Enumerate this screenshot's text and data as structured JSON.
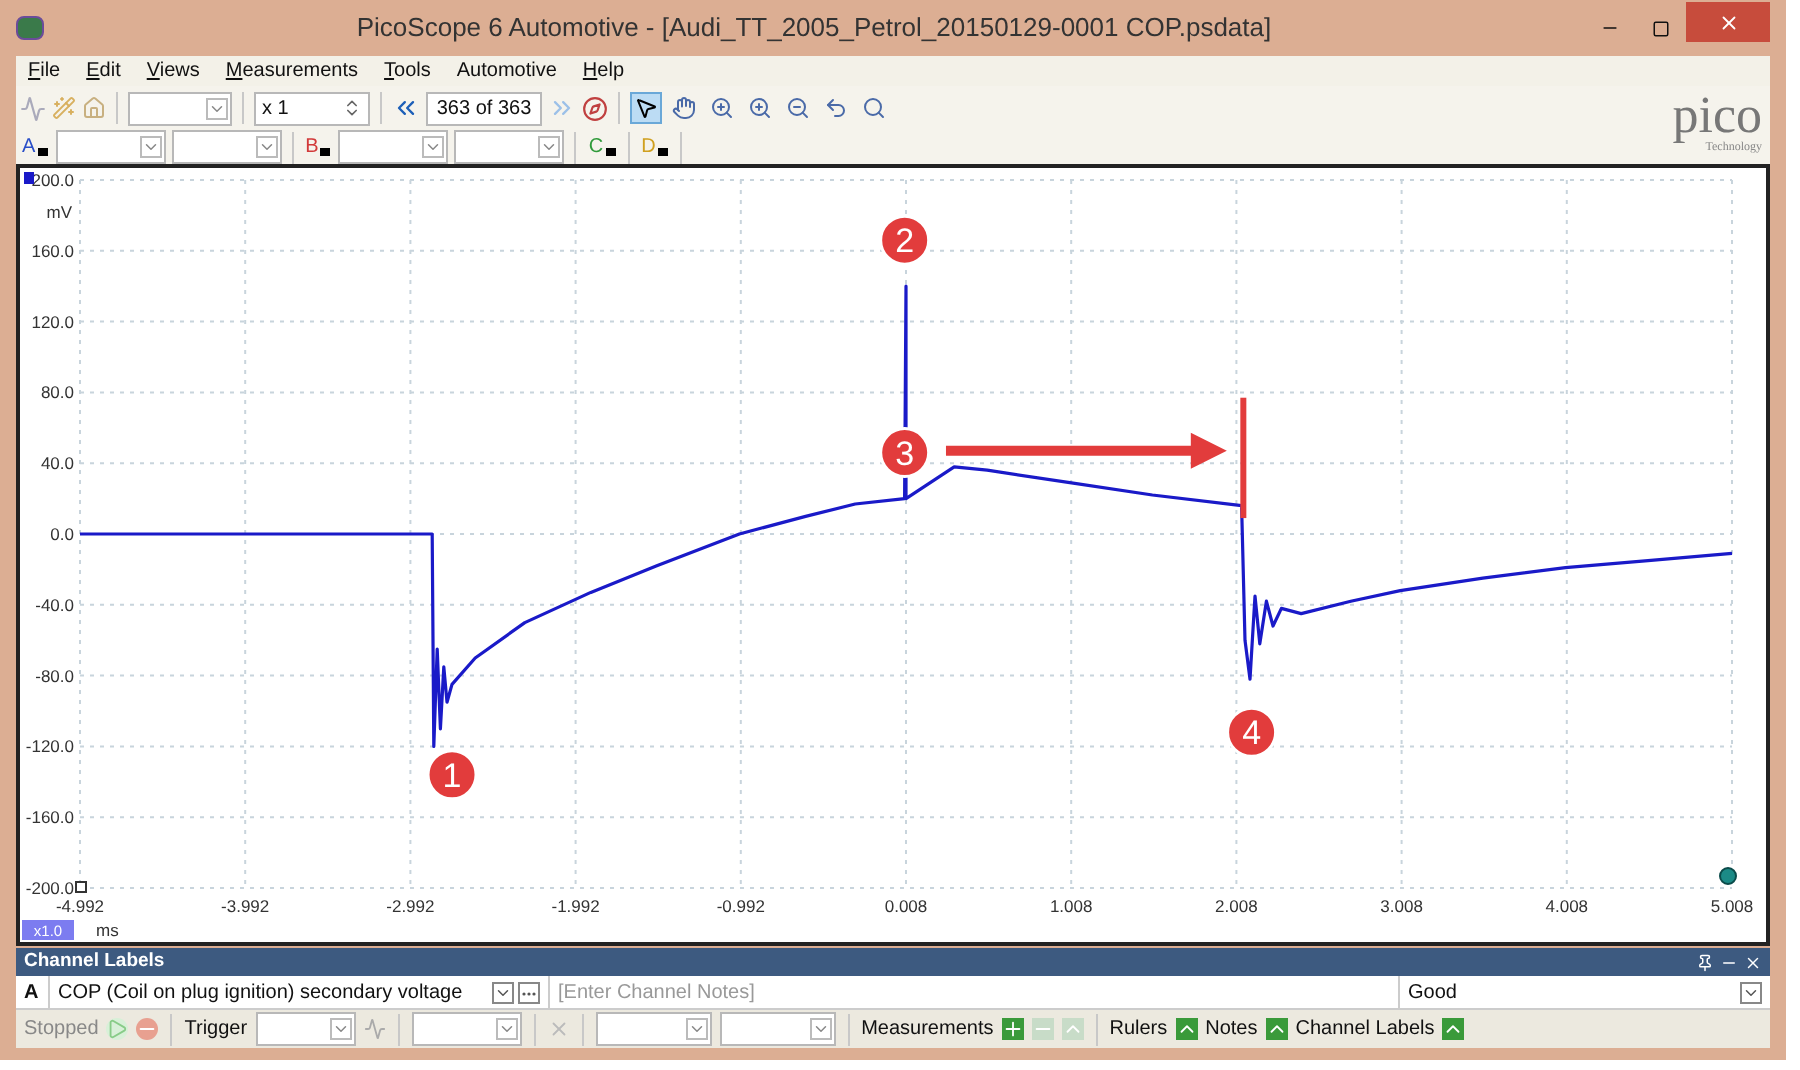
{
  "window": {
    "title": "PicoScope 6 Automotive - [Audi_TT_2005_Petrol_20150129-0001 COP.psdata]"
  },
  "menu": [
    {
      "label": "File",
      "underlined": true
    },
    {
      "label": "Edit",
      "underlined": true
    },
    {
      "label": "Views",
      "underlined": true
    },
    {
      "label": "Measurements",
      "underlined": true
    },
    {
      "label": "Tools",
      "underlined": true
    },
    {
      "label": "Automotive",
      "underlined": false
    },
    {
      "label": "Help",
      "underlined": true
    }
  ],
  "toolbar": {
    "zoom": "x 1",
    "page": "363 of 363",
    "tools": [
      {
        "kind": "pointer",
        "selected": true
      },
      {
        "kind": "hand",
        "selected": false
      },
      {
        "kind": "zoom-in",
        "selected": false
      },
      {
        "kind": "zoom-area",
        "selected": false
      },
      {
        "kind": "zoom-out",
        "selected": false
      },
      {
        "kind": "undo",
        "selected": false
      },
      {
        "kind": "zoom-fit",
        "selected": false
      }
    ]
  },
  "logo": {
    "text": "pico",
    "subtitle": "Technology"
  },
  "channels": [
    {
      "label": "A",
      "color": "#2a4fc8"
    },
    {
      "label": "B",
      "color": "#d23a3a"
    },
    {
      "label": "C",
      "color": "#2f9a3a"
    },
    {
      "label": "D",
      "color": "#d0a020"
    }
  ],
  "plot": {
    "zoom_badge": "x1.0",
    "callouts": [
      {
        "text": "1"
      },
      {
        "text": "2"
      },
      {
        "text": "3"
      },
      {
        "text": "4"
      }
    ],
    "chart_data": {
      "type": "line",
      "grid": true,
      "xlabel": "ms",
      "ylabel": "mV",
      "xlim": [
        -4.992,
        5.008
      ],
      "ylim": [
        -200,
        200
      ],
      "xticks": [
        -4.992,
        -3.992,
        -2.992,
        -1.992,
        -0.992,
        0.008,
        1.008,
        2.008,
        3.008,
        4.008,
        5.008
      ],
      "yticks": [
        {
          "value": 200,
          "label": "200.0"
        },
        {
          "value": 160,
          "label": "160.0"
        },
        {
          "value": 120,
          "label": "120.0"
        },
        {
          "value": 80,
          "label": "80.0"
        },
        {
          "value": 40,
          "label": "40.0"
        },
        {
          "value": 0,
          "label": "0.0"
        },
        {
          "value": -40,
          "label": "-40.0"
        },
        {
          "value": -80,
          "label": "-80.0"
        },
        {
          "value": -120,
          "label": "-120.0"
        },
        {
          "value": -160,
          "label": "-160.0"
        },
        {
          "value": -200,
          "label": "-200.0"
        }
      ],
      "x": [
        -4.992,
        -2.86,
        -2.85,
        -2.83,
        -2.81,
        -2.79,
        -2.77,
        -2.74,
        -2.6,
        -2.3,
        -1.9,
        -1.5,
        -1.0,
        -0.6,
        -0.3,
        0.0,
        0.008,
        0.008,
        0.3,
        0.5,
        1.0,
        1.5,
        2.04,
        2.06,
        2.09,
        2.12,
        2.15,
        2.19,
        2.23,
        2.28,
        2.4,
        2.7,
        3.0,
        3.5,
        4.0,
        4.5,
        5.008
      ],
      "series": [
        {
          "color": "#1a1ac8",
          "values": [
            0,
            0,
            -120,
            -65,
            -110,
            -75,
            -95,
            -85,
            -70,
            -50,
            -33,
            -18,
            0,
            10,
            17,
            20,
            140,
            20,
            38,
            36,
            29,
            22,
            16,
            -60,
            -82,
            -35,
            -62,
            -38,
            -52,
            -42,
            -45,
            -38,
            -32,
            -25,
            -19,
            -15,
            -11
          ]
        }
      ]
    }
  },
  "channel_labels": {
    "title": "Channel Labels",
    "channel": "A",
    "label": "COP (Coil on plug ignition) secondary voltage",
    "notes_placeholder": "[Enter Channel Notes]",
    "status": "Good"
  },
  "status_bar": {
    "state": "Stopped",
    "trigger": "Trigger",
    "items": [
      "Measurements",
      "Rulers",
      "Notes",
      "Channel Labels"
    ]
  }
}
